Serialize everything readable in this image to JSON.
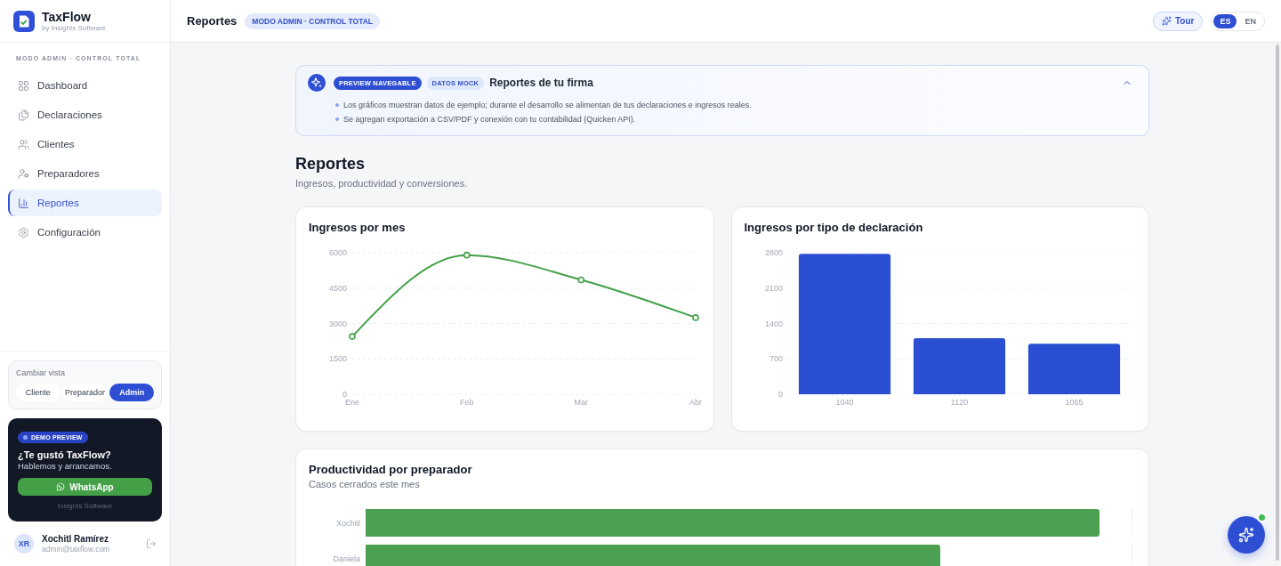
{
  "sidebar": {
    "brand": {
      "name": "TaxFlow",
      "tagline": "by Insights Software"
    },
    "section_label": "MODO ADMIN · CONTROL TOTAL",
    "items": [
      {
        "label": "Dashboard",
        "selected": false
      },
      {
        "label": "Declaraciones",
        "selected": false
      },
      {
        "label": "Clientes",
        "selected": false
      },
      {
        "label": "Preparadores",
        "selected": false
      },
      {
        "label": "Reportes",
        "selected": true
      },
      {
        "label": "Configuración",
        "selected": false
      }
    ],
    "view_switcher": {
      "label": "Cambiar vista",
      "options": [
        {
          "label": "Cliente",
          "selected": false
        },
        {
          "label": "Preparador",
          "selected": false
        },
        {
          "label": "Admin",
          "selected": true
        }
      ]
    },
    "promo": {
      "badge": "DEMO PREVIEW",
      "title": "¿Te gustó TaxFlow?",
      "text": "Hablemos y arrancamos.",
      "button": "WhatsApp",
      "footer": "Insights Software"
    },
    "user": {
      "initials": "XR",
      "name": "Xochitl Ramírez",
      "email": "admin@taxflow.com"
    }
  },
  "header": {
    "title": "Reportes",
    "badge": "MODO ADMIN · CONTROL TOTAL",
    "tour_button": "Tour",
    "languages": [
      {
        "label": "ES",
        "selected": true
      },
      {
        "label": "EN",
        "selected": false
      }
    ]
  },
  "banner": {
    "tags": [
      {
        "label": "PREVIEW NAVEGABLE",
        "kind": "solid"
      },
      {
        "label": "DATOS MOCK",
        "kind": "soft"
      }
    ],
    "title": "Reportes de tu firma",
    "expanded": true,
    "bullets": [
      "Los gráficos muestran datos de ejemplo; durante el desarrollo se alimentan de tus declaraciones e ingresos reales.",
      "Se agregan exportación a CSV/PDF y conexión con tu contabilidad (Quicken API)."
    ]
  },
  "page": {
    "title": "Reportes",
    "subtitle": "Ingresos, productividad y conversiones."
  },
  "charts": [
    {
      "chart_data": {
        "type": "line",
        "title": "Ingresos por mes",
        "categories": [
          "Ene",
          "Feb",
          "Mar",
          "Abr"
        ],
        "values": [
          2450,
          5900,
          4850,
          3250
        ],
        "ylim": [
          0,
          6000
        ],
        "yticks": [
          0,
          1500,
          3000,
          4500,
          6000
        ],
        "grid": true,
        "marker": true
      }
    },
    {
      "chart_data": {
        "type": "bar",
        "title": "Ingresos por tipo de declaración",
        "categories": [
          "1040",
          "1120",
          "1065"
        ],
        "values": [
          2780,
          1110,
          1000
        ],
        "ylim": [
          0,
          2800
        ],
        "yticks": [
          0,
          700,
          1400,
          2100,
          2800
        ],
        "grid": true
      }
    }
  ],
  "productivity": {
    "title": "Productividad por preparador",
    "subtitle": "Casos cerrados este mes",
    "rows": [
      {
        "name": "Xochitl",
        "level": 0.958
      },
      {
        "name": "Daniela",
        "level": 0.75
      }
    ]
  },
  "assistant_button": {
    "online": true
  }
}
